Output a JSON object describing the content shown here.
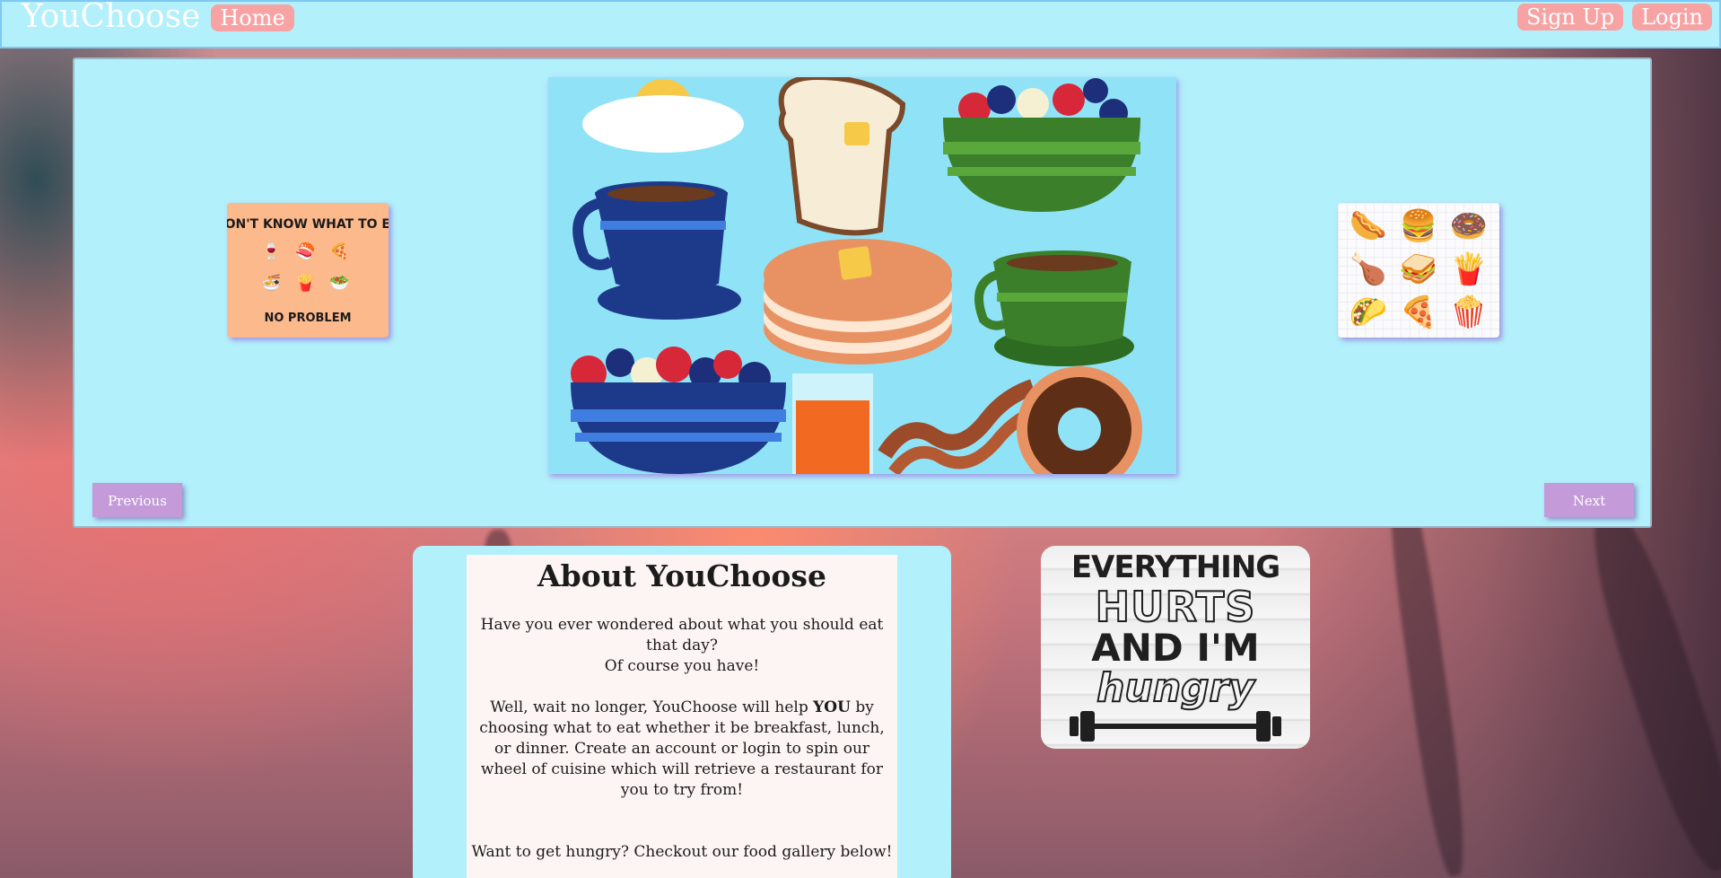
{
  "navbar": {
    "brand": "YouChoose",
    "home": "Home",
    "sign_up": "Sign Up",
    "login": "Login"
  },
  "carousel": {
    "prev_label": "Previous",
    "next_label": "Next",
    "left_slide": {
      "title": "DON'T KNOW WHAT TO EAT",
      "footer": "NO PROBLEM",
      "icons": [
        "🍷",
        "🍣",
        "🍕",
        "🍜",
        "🍟",
        "🥗"
      ]
    },
    "main_slide": {
      "icons": [
        "🍳",
        "🍞",
        "🍓",
        "☕",
        "🥞",
        "🍵",
        "🥣",
        "🧃",
        "🥓",
        "🍩"
      ]
    },
    "right_slide": {
      "icons": [
        "🌭",
        "🍔",
        "🍩",
        "🍗",
        "🥪",
        "🍟",
        "🌮",
        "🍕",
        "🍿"
      ]
    }
  },
  "about": {
    "title": "About YouChoose",
    "p1": "Have you ever wondered about what you should eat that day?",
    "p2": "Of course you have!",
    "p3_before": "Well, wait no longer, YouChoose will help ",
    "p3_bold": "YOU",
    "p3_after": " by choosing what to eat whether it be breakfast, lunch, or dinner. Create an account or login to spin our wheel of cuisine which will retrieve a restaurant for you to try from!",
    "p4": "Want to get hungry? Checkout our food gallery below!"
  },
  "hungry": {
    "line1": "EVERYTHING",
    "line2": "HURTS",
    "line3": "AND I'M",
    "line4": "hungry"
  }
}
